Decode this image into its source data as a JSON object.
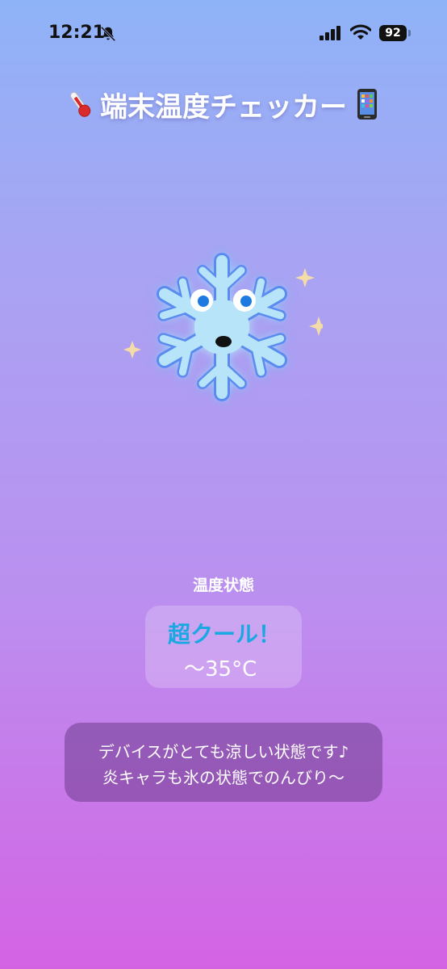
{
  "status_bar": {
    "time": "12:21",
    "battery": "92",
    "icons": [
      "bell-slash-icon",
      "signal-icon",
      "wifi-icon",
      "battery-icon"
    ]
  },
  "header": {
    "title": "端末温度チェッカー",
    "left_icon": "thermometer-icon",
    "right_icon": "mobile-phone-icon"
  },
  "mascot": {
    "name": "snowflake-mascot-icon",
    "color": "#a9dcf4"
  },
  "temperature": {
    "section_label": "温度状態",
    "status": "超クール！",
    "range": "～35°C",
    "status_color": "#1aa8e3"
  },
  "message": {
    "line1": "デバイスがとても涼しい状態です♪",
    "line2": "炎キャラも氷の状態でのんびり～"
  }
}
